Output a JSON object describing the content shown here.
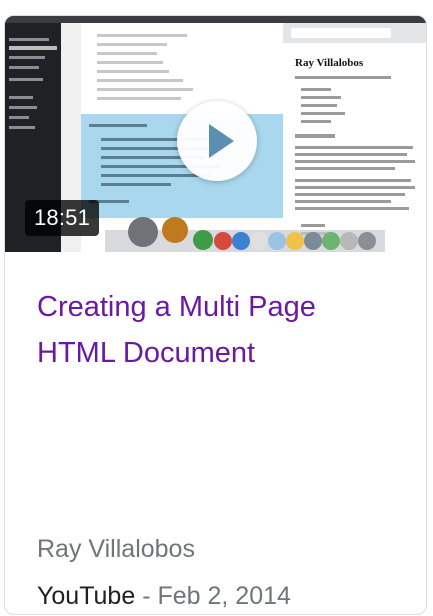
{
  "video": {
    "duration": "18:51",
    "title": "Creating a Multi Page HTML Document",
    "author": "Ray Villalobos",
    "source": "YouTube",
    "separator": " - ",
    "date": "Feb 2, 2014"
  },
  "thumbnail": {
    "browser_heading": "Ray Villalobos",
    "play_icon_color": "#5b8fb0",
    "editor_bg": "#ffffff",
    "selection_color": "#9fd3ec"
  }
}
